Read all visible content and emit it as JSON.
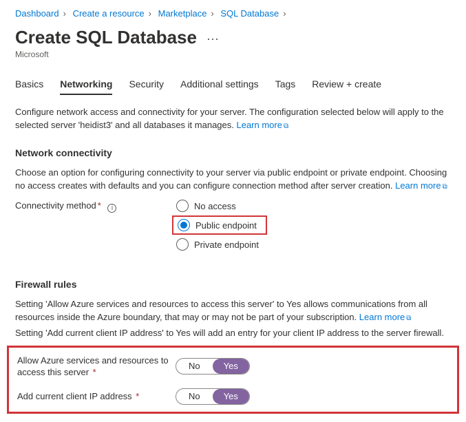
{
  "breadcrumb": {
    "items": [
      "Dashboard",
      "Create a resource",
      "Marketplace",
      "SQL Database"
    ]
  },
  "header": {
    "title": "Create SQL Database",
    "subtitle": "Microsoft"
  },
  "tabs": {
    "items": [
      "Basics",
      "Networking",
      "Security",
      "Additional settings",
      "Tags",
      "Review + create"
    ],
    "active_index": 1
  },
  "intro": {
    "text_before": "Configure network access and connectivity for your server. The configuration selected below will apply to the selected server 'heidist3' and all databases it manages. ",
    "learn_more": "Learn more"
  },
  "network": {
    "section_title": "Network connectivity",
    "desc_before": "Choose an option for configuring connectivity to your server via public endpoint or private endpoint. Choosing no access creates with defaults and you can configure connection method after server creation. ",
    "learn_more": "Learn more",
    "field_label": "Connectivity method",
    "options": [
      "No access",
      "Public endpoint",
      "Private endpoint"
    ],
    "selected_index": 1
  },
  "firewall": {
    "section_title": "Firewall rules",
    "desc1_before": "Setting 'Allow Azure services and resources to access this server' to Yes allows communications from all resources inside the Azure boundary, that may or may not be part of your subscription. ",
    "learn_more": "Learn more",
    "desc2": "Setting 'Add current client IP address' to Yes will add an entry for your client IP address to the server firewall.",
    "rows": [
      {
        "label": "Allow Azure services and resources to access this server",
        "no": "No",
        "yes": "Yes",
        "selected": "yes"
      },
      {
        "label": "Add current client IP address",
        "no": "No",
        "yes": "Yes",
        "selected": "yes"
      }
    ]
  }
}
